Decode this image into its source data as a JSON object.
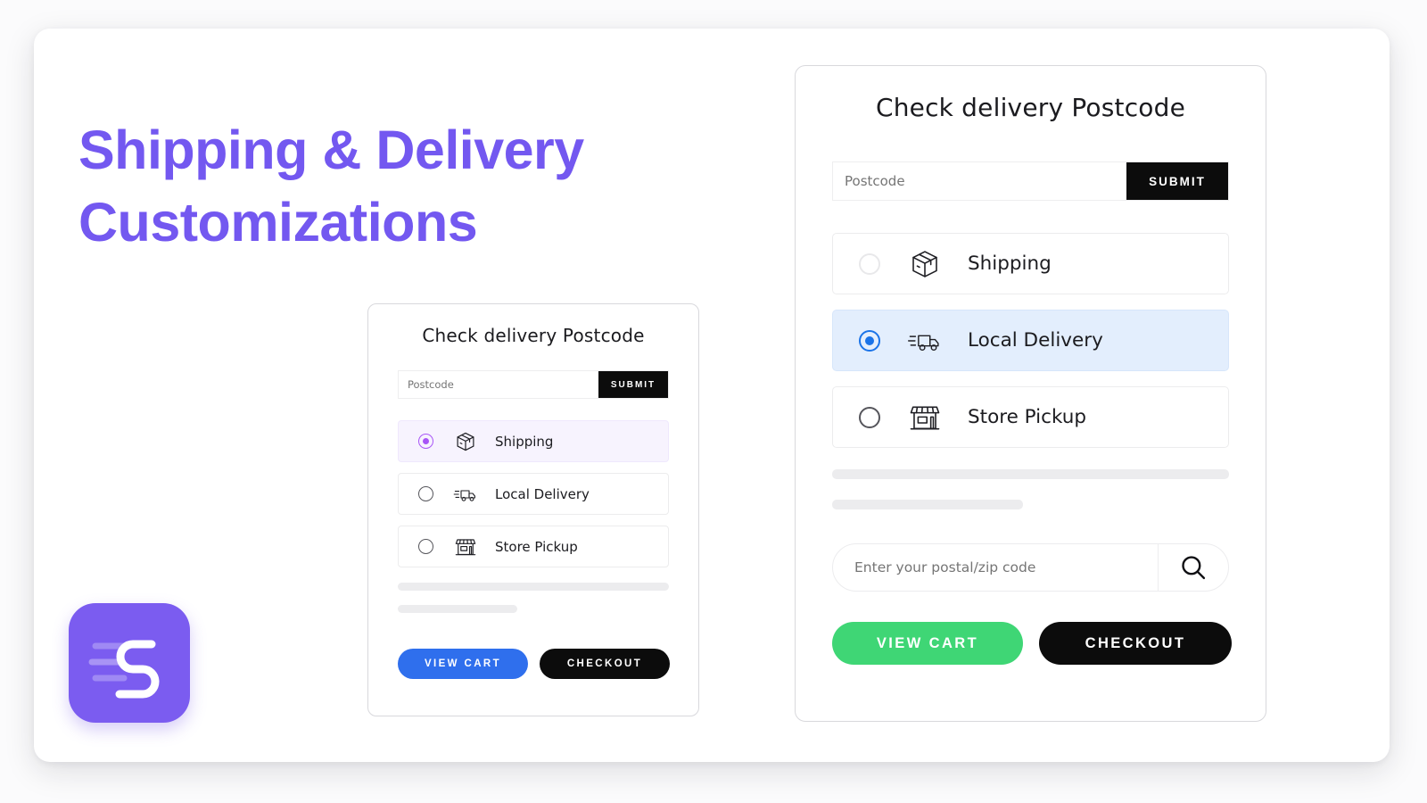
{
  "page": {
    "background": "#fbfbfc",
    "frame_background": "#ffffff"
  },
  "headline": {
    "line1": "Shipping & Delivery",
    "line2": "Customizations",
    "color": "#7358f0"
  },
  "logo": {
    "name": "shipping-app-logo",
    "letter": "S",
    "background": "#7b5cf0",
    "mark_color": "#ffffff"
  },
  "left_card": {
    "title": "Check delivery Postcode",
    "postcode": {
      "placeholder": "Postcode",
      "value": "",
      "submit_label": "SUBMIT",
      "submit_bg": "#0c0c0c"
    },
    "options": [
      {
        "label": "Shipping",
        "icon": "package-box-icon",
        "selected": true
      },
      {
        "label": "Local Delivery",
        "icon": "delivery-truck-icon",
        "selected": false
      },
      {
        "label": "Store Pickup",
        "icon": "storefront-icon",
        "selected": false
      }
    ],
    "selected_option": "Shipping",
    "accent_color": "#a855f7",
    "selected_row_bg": "#f7f3fe",
    "buttons": {
      "view_cart": "VIEW CART",
      "view_cart_bg": "#2f6fed",
      "checkout": "CHECKOUT",
      "checkout_bg": "#0c0c0c"
    }
  },
  "right_card": {
    "title": "Check delivery Postcode",
    "postcode": {
      "placeholder": "Postcode",
      "value": "",
      "submit_label": "SUBMIT",
      "submit_bg": "#0c0c0c"
    },
    "options": [
      {
        "label": "Shipping",
        "icon": "package-box-icon",
        "selected": false
      },
      {
        "label": "Local Delivery",
        "icon": "delivery-truck-icon",
        "selected": true
      },
      {
        "label": "Store Pickup",
        "icon": "storefront-icon",
        "selected": false
      }
    ],
    "selected_option": "Local Delivery",
    "accent_color": "#1a73e8",
    "selected_row_bg": "#e3eefd",
    "search": {
      "placeholder": "Enter your postal/zip code",
      "value": "",
      "icon": "search-icon"
    },
    "buttons": {
      "view_cart": "VIEW CART",
      "view_cart_bg": "#3fd675",
      "checkout": "CHECKOUT",
      "checkout_bg": "#0c0c0c"
    }
  }
}
